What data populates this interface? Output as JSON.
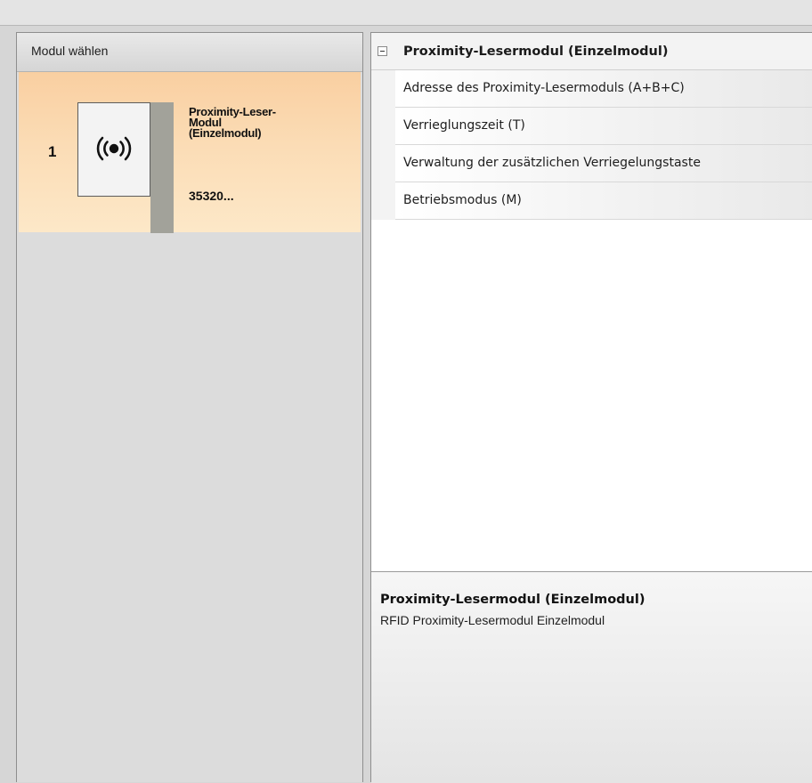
{
  "left_panel": {
    "header": "Modul wählen",
    "module": {
      "number": "1",
      "name": "Proximity-Leser-\nModul\n(Einzelmodul)",
      "code": "35320...",
      "icon": "rfid-signal-icon"
    }
  },
  "properties": {
    "group_title": "Proximity-Lesermodul (Einzelmodul)",
    "rows": [
      "Adresse des Proximity-Lesermoduls (A+B+C)",
      "Verrieglungszeit (T)",
      "Verwaltung der zusätzlichen Verriegelungstaste",
      "Betriebsmodus (M)"
    ]
  },
  "description": {
    "title": "Proximity-Lesermodul (Einzelmodul)",
    "text": "RFID Proximity-Lesermodul Einzelmodul"
  },
  "colors": {
    "card_highlight": "#fbdcb5",
    "panel_bg": "#dcdcdc"
  }
}
